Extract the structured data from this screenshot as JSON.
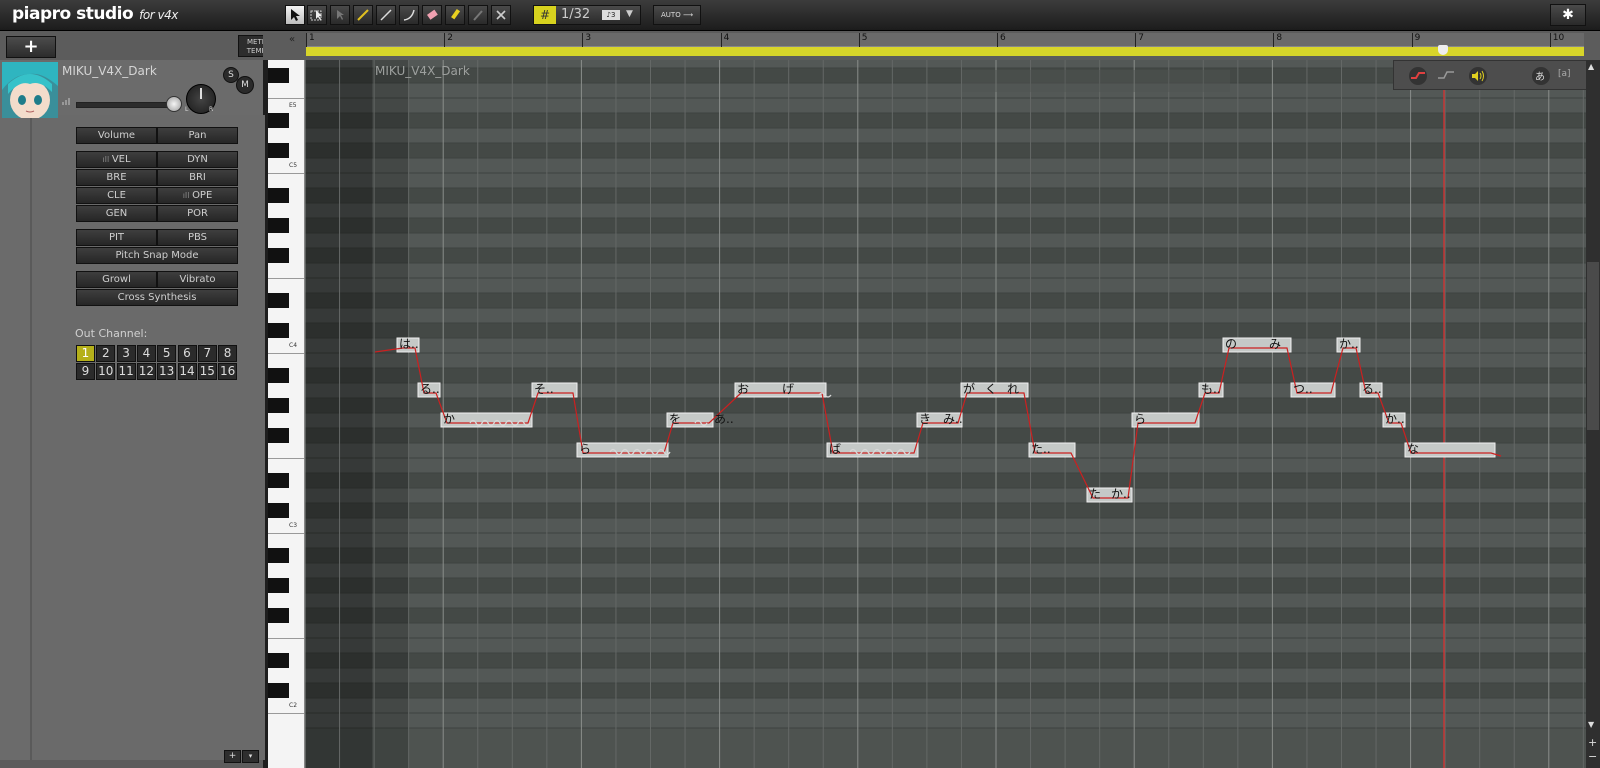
{
  "app": {
    "logo_main": "piapro studio",
    "logo_sub": "for v4x"
  },
  "toolbar": {
    "tools": [
      "select-tool",
      "region-select-tool",
      "multi-select-tool",
      "pencil-tool",
      "line-tool",
      "curve-tool",
      "eraser-tool",
      "highlighter-tool",
      "pen-tool",
      "delete-tool"
    ],
    "quantize": "1/32",
    "quantize_type": "♪3",
    "auto_label": "AUTO",
    "settings_icon": "gear-icon"
  },
  "track": {
    "add_label": "+",
    "meter_tempo": "METER TEMPO",
    "name": "MIKU_V4X_Dark",
    "solo": "S",
    "mute": "M",
    "volume_level": 0.92,
    "pan_left": "L",
    "pan_right": "R"
  },
  "params": {
    "row1": [
      "Volume",
      "Pan"
    ],
    "row2": [
      "VEL",
      "DYN",
      "BRE",
      "BRI",
      "CLE",
      "OPE",
      "GEN",
      "POR"
    ],
    "row3": [
      "PIT",
      "PBS",
      "Pitch Snap Mode"
    ],
    "row4": [
      "Growl",
      "Vibrato",
      "Cross Synthesis"
    ]
  },
  "out_channel": {
    "label": "Out Channel:",
    "channels": [
      "1",
      "2",
      "3",
      "4",
      "5",
      "6",
      "7",
      "8",
      "9",
      "10",
      "11",
      "12",
      "13",
      "14",
      "15",
      "16"
    ],
    "selected": "1"
  },
  "ruler": {
    "bars": [
      "1",
      "2",
      "3",
      "4",
      "5",
      "6",
      "7",
      "8",
      "9",
      "10"
    ]
  },
  "keyboard": {
    "labels": [
      "E5",
      "C5",
      "C4",
      "C3",
      "C2"
    ]
  },
  "roll": {
    "track_label": "MIKU_V4X_Dark",
    "notes": [
      {
        "lyric": "は"
      },
      {
        "lyric": "る"
      },
      {
        "lyric": "か"
      },
      {
        "lyric": "そ"
      },
      {
        "lyric": "ら"
      },
      {
        "lyric": "を"
      },
      {
        "lyric": "あ"
      },
      {
        "lyric": "お"
      },
      {
        "lyric": "げ"
      },
      {
        "lyric": "ば"
      },
      {
        "lyric": "き"
      },
      {
        "lyric": "み"
      },
      {
        "lyric": "が"
      },
      {
        "lyric": "く"
      },
      {
        "lyric": "れ"
      },
      {
        "lyric": "た"
      },
      {
        "lyric": "た"
      },
      {
        "lyric": "か"
      },
      {
        "lyric": "ら"
      },
      {
        "lyric": "も"
      },
      {
        "lyric": "の"
      },
      {
        "lyric": "み"
      },
      {
        "lyric": "つ"
      },
      {
        "lyric": "か"
      },
      {
        "lyric": "る"
      },
      {
        "lyric": "か"
      },
      {
        "lyric": "な"
      }
    ]
  },
  "bottom": {
    "plus": "+",
    "down": "▾"
  }
}
